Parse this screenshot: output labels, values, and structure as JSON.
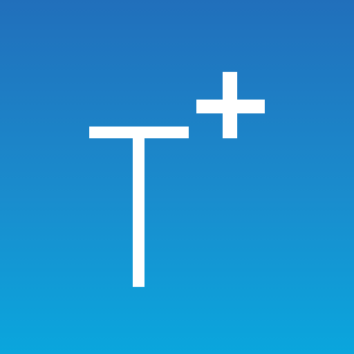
{
  "icon": {
    "glyph": "T+",
    "colors": {
      "gradient_top": "#216fbb",
      "gradient_mid": "#1a8ccd",
      "gradient_bottom": "#0aa6dd",
      "glyph": "#ffffff"
    }
  }
}
